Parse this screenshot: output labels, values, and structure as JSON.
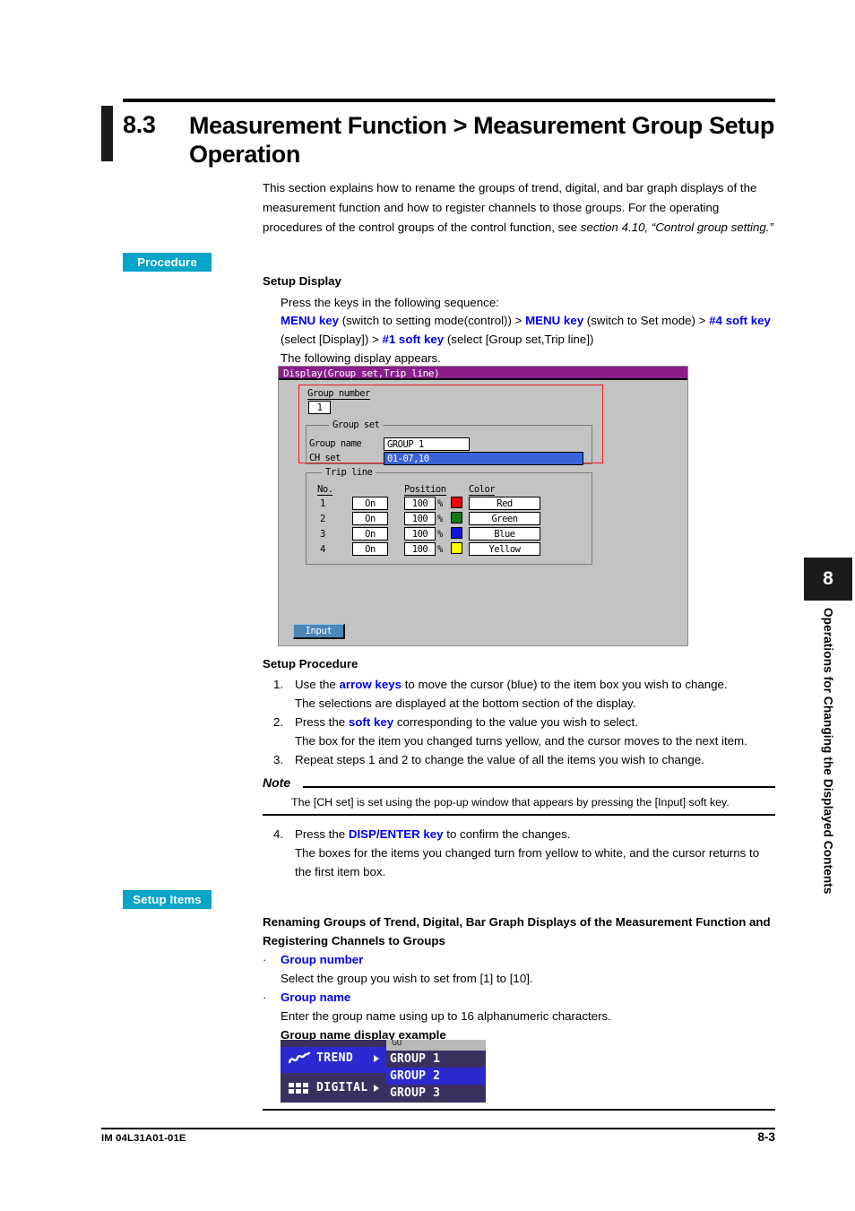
{
  "heading": {
    "number": "8.3",
    "title": "Measurement Function > Measurement Group Setup Operation"
  },
  "intro": {
    "part1": "This section explains how to rename the groups of trend, digital, and bar graph displays of the measurement function and how to register channels to those groups.  For the operating procedures of the control groups of the control function, see ",
    "italic1": "section 4.10,",
    "italic2": "“Control group setting.”"
  },
  "badges": {
    "procedure": "Procedure",
    "setup_items": "Setup Items"
  },
  "setup_display": {
    "heading": "Setup Display",
    "line1": "Press the keys in the following sequence:",
    "seq": {
      "k1": "MENU key",
      "t1": " (switch to setting mode(control)) > ",
      "k2": "MENU key",
      "t2": " (switch to Set mode) > ",
      "k3": "#4 soft key",
      "t3": " (select [Display]) > ",
      "k4": "#1 soft key",
      "t4": " (select [Group set,Trip line])"
    },
    "line3": "The following display appears."
  },
  "device": {
    "title": "Display(Group set,Trip line)",
    "group_number_label": "Group number",
    "group_number_value": "1",
    "group_set_caption": "Group set",
    "group_name_label": "Group name",
    "group_name_value": "GROUP 1",
    "ch_set_label": "CH set",
    "ch_set_value": "01-07,10",
    "trip_line_caption": "Trip line",
    "columns": {
      "no": "No.",
      "position": "Position",
      "color": "Color"
    },
    "percent": "%",
    "rows": [
      {
        "no": "1",
        "state": "On",
        "position": "100",
        "color_name": "Red",
        "color_hex": "#ff0000"
      },
      {
        "no": "2",
        "state": "On",
        "position": "100",
        "color_name": "Green",
        "color_hex": "#117a11"
      },
      {
        "no": "3",
        "state": "On",
        "position": "100",
        "color_name": "Blue",
        "color_hex": "#1414dd"
      },
      {
        "no": "4",
        "state": "On",
        "position": "100",
        "color_name": "Yellow",
        "color_hex": "#ffff00"
      }
    ],
    "softkey_input": "Input"
  },
  "setup_procedure": {
    "heading": "Setup Procedure",
    "steps": [
      {
        "n": "1.",
        "pre": "Use the ",
        "key": "arrow keys",
        "post": " to move the cursor (blue) to the item box you wish to change.",
        "sub": "The selections are displayed at the bottom section of the display."
      },
      {
        "n": "2.",
        "pre": "Press the ",
        "key": "soft key",
        "post": " corresponding to the value you wish to select.",
        "sub": "The box for the item you changed turns yellow, and the cursor moves to the next item."
      },
      {
        "n": "3.",
        "pre": "Repeat steps 1 and 2 to change the value of all the items you wish to change.",
        "key": "",
        "post": "",
        "sub": ""
      },
      {
        "n": "4.",
        "pre": "Press the ",
        "key": "DISP/ENTER key",
        "post": " to confirm the changes.",
        "sub": "The boxes for the items you changed turn from yellow to white, and the cursor returns to the first item box."
      }
    ]
  },
  "note": {
    "heading": "Note",
    "body": "The [CH set] is set using the pop-up window that appears by pressing the [Input] soft key."
  },
  "setup_items": {
    "heading": "Renaming Groups of Trend, Digital, Bar Graph Displays of the Measurement Function and Registering Channels to Groups",
    "bullets": [
      {
        "label": "Group number",
        "desc": "Select the group you wish to set from [1] to [10]."
      },
      {
        "label": "Group name",
        "desc": "Enter the group name using up to 16 alphanumeric characters."
      }
    ],
    "example_heading": "Group name display example"
  },
  "group_example": {
    "top_partial": "GU",
    "menu": [
      {
        "label": "TREND",
        "icon": "trend-waveform-icon",
        "selected": true
      },
      {
        "label": "DIGITAL",
        "icon": "digital-grid-icon",
        "selected": false
      }
    ],
    "groups": [
      {
        "label": "GROUP 1",
        "highlighted": false
      },
      {
        "label": "GROUP 2",
        "highlighted": true
      },
      {
        "label": "GROUP 3",
        "highlighted": false
      }
    ]
  },
  "chapter_tab": {
    "number": "8",
    "text": "Operations for Changing the Displayed Contents"
  },
  "footer": {
    "left": "IM 04L31A01-01E",
    "right": "8-3"
  }
}
